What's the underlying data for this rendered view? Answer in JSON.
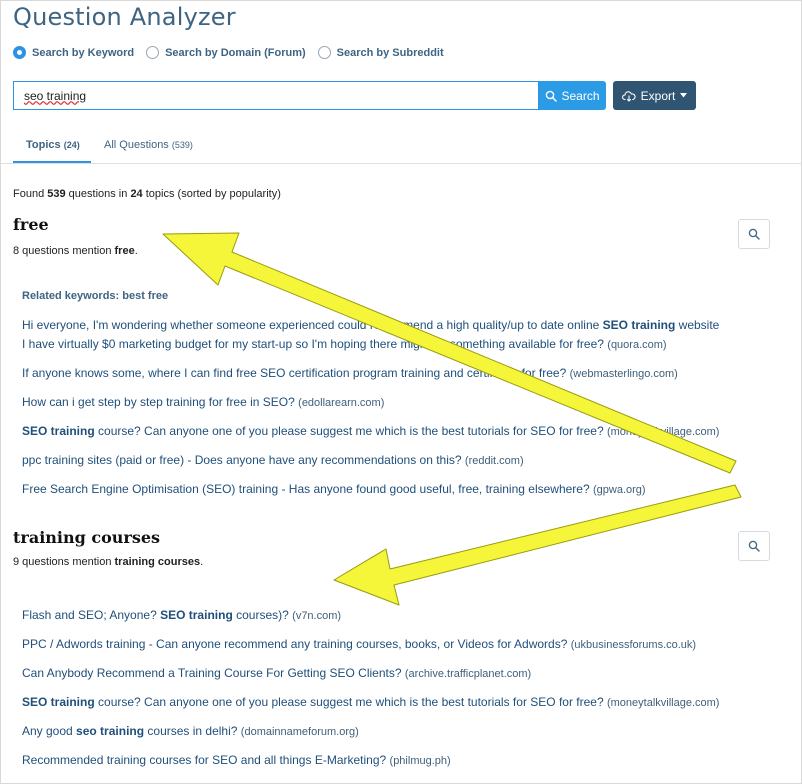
{
  "app": {
    "title": "Question Analyzer"
  },
  "search_modes": [
    {
      "label": "Search by Keyword",
      "selected": true
    },
    {
      "label": "Search by Domain (Forum)",
      "selected": false
    },
    {
      "label": "Search by Subreddit",
      "selected": false
    }
  ],
  "search": {
    "value": "seo training",
    "button_label": "Search",
    "export_label": "Export"
  },
  "tabs": [
    {
      "label": "Topics",
      "count": "(24)",
      "active": true
    },
    {
      "label": "All Questions",
      "count": "(539)",
      "active": false
    }
  ],
  "summary": {
    "prefix": "Found ",
    "questions": "539",
    "mid1": " questions in ",
    "topics": "24",
    "suffix": " topics (sorted by popularity)"
  },
  "topics": [
    {
      "title": "free",
      "mention_prefix": "8 questions mention ",
      "mention_term": "free",
      "mention_suffix": ".",
      "related": "Related keywords: best free",
      "questions": [
        {
          "pre": "Hi everyone, I'm wondering whether someone experienced could recommend a high quality/up to date online ",
          "bold": "SEO training",
          "post": " website",
          "line2": "I have virtually $0 marketing budget for my start-up so I'm hoping there might be something available for free?",
          "domain": "(quora.com)"
        },
        {
          "pre": "If anyone knows some, where I can find free SEO certification program training and certificate for free?",
          "bold": "",
          "post": "",
          "domain": "(webmasterlingo.com)"
        },
        {
          "pre": "How can i get step by step training for free in SEO?",
          "bold": "",
          "post": "",
          "domain": "(edollarearn.com)"
        },
        {
          "pre": "",
          "bold": "SEO training",
          "post": " course? Can anyone one of you please suggest me which is the best tutorials for SEO for free?",
          "domain": "(moneytalkvillage.com)"
        },
        {
          "pre": "ppc training sites (paid or free) - Does anyone have any recommendations on this?",
          "bold": "",
          "post": "",
          "domain": "(reddit.com)"
        },
        {
          "pre": "Free Search Engine Optimisation (SEO) training - Has anyone found good useful, free, training elsewhere?",
          "bold": "",
          "post": "",
          "domain": "(gpwa.org)"
        }
      ]
    },
    {
      "title": "training courses",
      "mention_prefix": "9 questions mention ",
      "mention_term": "training courses",
      "mention_suffix": ".",
      "questions": [
        {
          "pre": "Flash and SEO; Anyone? ",
          "bold": "SEO training",
          "post": " courses)?",
          "domain": "(v7n.com)"
        },
        {
          "pre": "PPC / Adwords training - Can anyone recommend any training courses, books, or Videos for Adwords?",
          "bold": "",
          "post": "",
          "domain": "(ukbusinessforums.co.uk)"
        },
        {
          "pre": "Can Anybody Recommend a Training Course For Getting SEO Clients?",
          "bold": "",
          "post": "",
          "domain": "(archive.trafficplanet.com)"
        },
        {
          "pre": "",
          "bold": "SEO training",
          "post": " course? Can anyone one of you please suggest me which is the best tutorials for SEO for free?",
          "domain": "(moneytalkvillage.com)"
        },
        {
          "pre": "Any good ",
          "bold": "seo training",
          "post": " courses in delhi?",
          "domain": "(domainnameforum.org)"
        },
        {
          "pre": "Recommended training courses for SEO and all things E-Marketing?",
          "bold": "",
          "post": "",
          "domain": "(philmug.ph)"
        }
      ]
    }
  ],
  "colors": {
    "accent": "#2b92e6",
    "heading": "#3e6483",
    "link": "#1f4f7a",
    "export": "#2f5572",
    "arrow": "#f5f53a"
  },
  "icons": [
    "search-icon",
    "cloud-download-icon",
    "caret-down-icon",
    "magnifier-icon",
    "arrow-annotation"
  ]
}
